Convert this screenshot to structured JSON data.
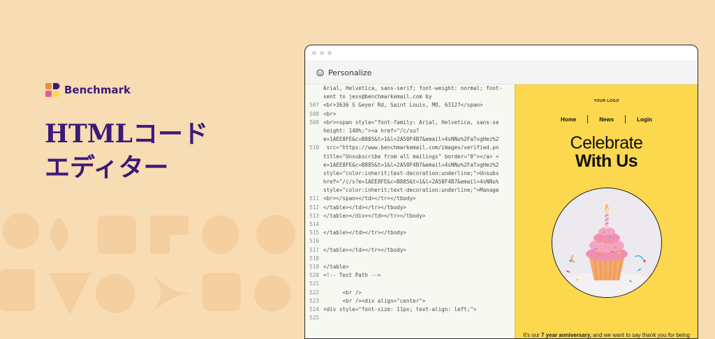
{
  "brand": {
    "name": "Benchmark",
    "colors": {
      "primary": "#3c1a78",
      "accent_orange": "#f28b3c",
      "accent_pink": "#e85c8a",
      "accent_yellow": "#fcd84e"
    }
  },
  "headline": {
    "line1": "HTMLコード",
    "line2": "エディター"
  },
  "window": {
    "toolbar_label": "Personalize",
    "toolbar_icon": "smiley-icon"
  },
  "code": {
    "lines": [
      {
        "n": "",
        "t": "Arial, Helvetica, sans-serif; font-weight: normal; font-"
      },
      {
        "n": "",
        "t": "sent to jess@benchmarkemail.com by"
      },
      {
        "n": "507",
        "t": "<br>3636 S Geyer Rd, Saint Louis, MO, 63127</span>"
      },
      {
        "n": "508",
        "t": "<br>"
      },
      {
        "n": "509",
        "t": "<br><span style=\"font-family: Arial, Helvetica, sans-se"
      },
      {
        "n": "",
        "t": "height: 140%;\"><a href=\"/c/su?"
      },
      {
        "n": "",
        "t": "e=1AEE8FE&c=B885&t=1&l=2A58F4B7&email=4sNNu%2FaTvgHez%2"
      },
      {
        "n": "510",
        "t": " src=\"https://www.benchmarkemail.com/images/verified.pn"
      },
      {
        "n": "",
        "t": "title=\"Unsubscribe from all mailings\" border=\"0\"></a> <"
      },
      {
        "n": "",
        "t": "e=1AEE8FE&c=B885&t=1&l=2A58F4B7&email=4sNNu%2FaTvgHez%2"
      },
      {
        "n": "",
        "t": "style=\"color:inherit;text-decoration:underline;\">Unsubs"
      },
      {
        "n": "",
        "t": "href=\"/c/s?e=1AEE8FE&c=B885&t=1&l=2A58F4B7&email=4sNNu%"
      },
      {
        "n": "",
        "t": "style=\"color:inherit;text-decoration:underline;\">Manage"
      },
      {
        "n": "511",
        "t": "<br></span></td></tr></tbody>"
      },
      {
        "n": "512",
        "t": "</table></td></tr></tbody>"
      },
      {
        "n": "513",
        "t": "</table></div></td></tr></tbody>"
      },
      {
        "n": "514",
        "t": ""
      },
      {
        "n": "515",
        "t": "</table></td></tr></tbody>"
      },
      {
        "n": "516",
        "t": ""
      },
      {
        "n": "517",
        "t": "</table></td></tr></tbody>"
      },
      {
        "n": "518",
        "t": ""
      },
      {
        "n": "519",
        "t": "</table>"
      },
      {
        "n": "520",
        "t": "<!-- Test Path -->"
      },
      {
        "n": "521",
        "t": ""
      },
      {
        "n": "522",
        "t": "      <br />"
      },
      {
        "n": "523",
        "t": "      <br /><div align=\"center\">"
      },
      {
        "n": "524",
        "t": "<div style=\"font-size: 11px; text-align: left;\">"
      },
      {
        "n": "525",
        "t": ""
      }
    ]
  },
  "preview": {
    "logo_text": "YOUR LOGO",
    "nav": [
      "Home",
      "News",
      "Login"
    ],
    "title1": "Celebrate",
    "title2": "With Us",
    "message_pre": "It's our ",
    "message_bold": "7 year anniversary,",
    "message_post": " and we want to say thank you for being part of {{StoreName}}."
  }
}
